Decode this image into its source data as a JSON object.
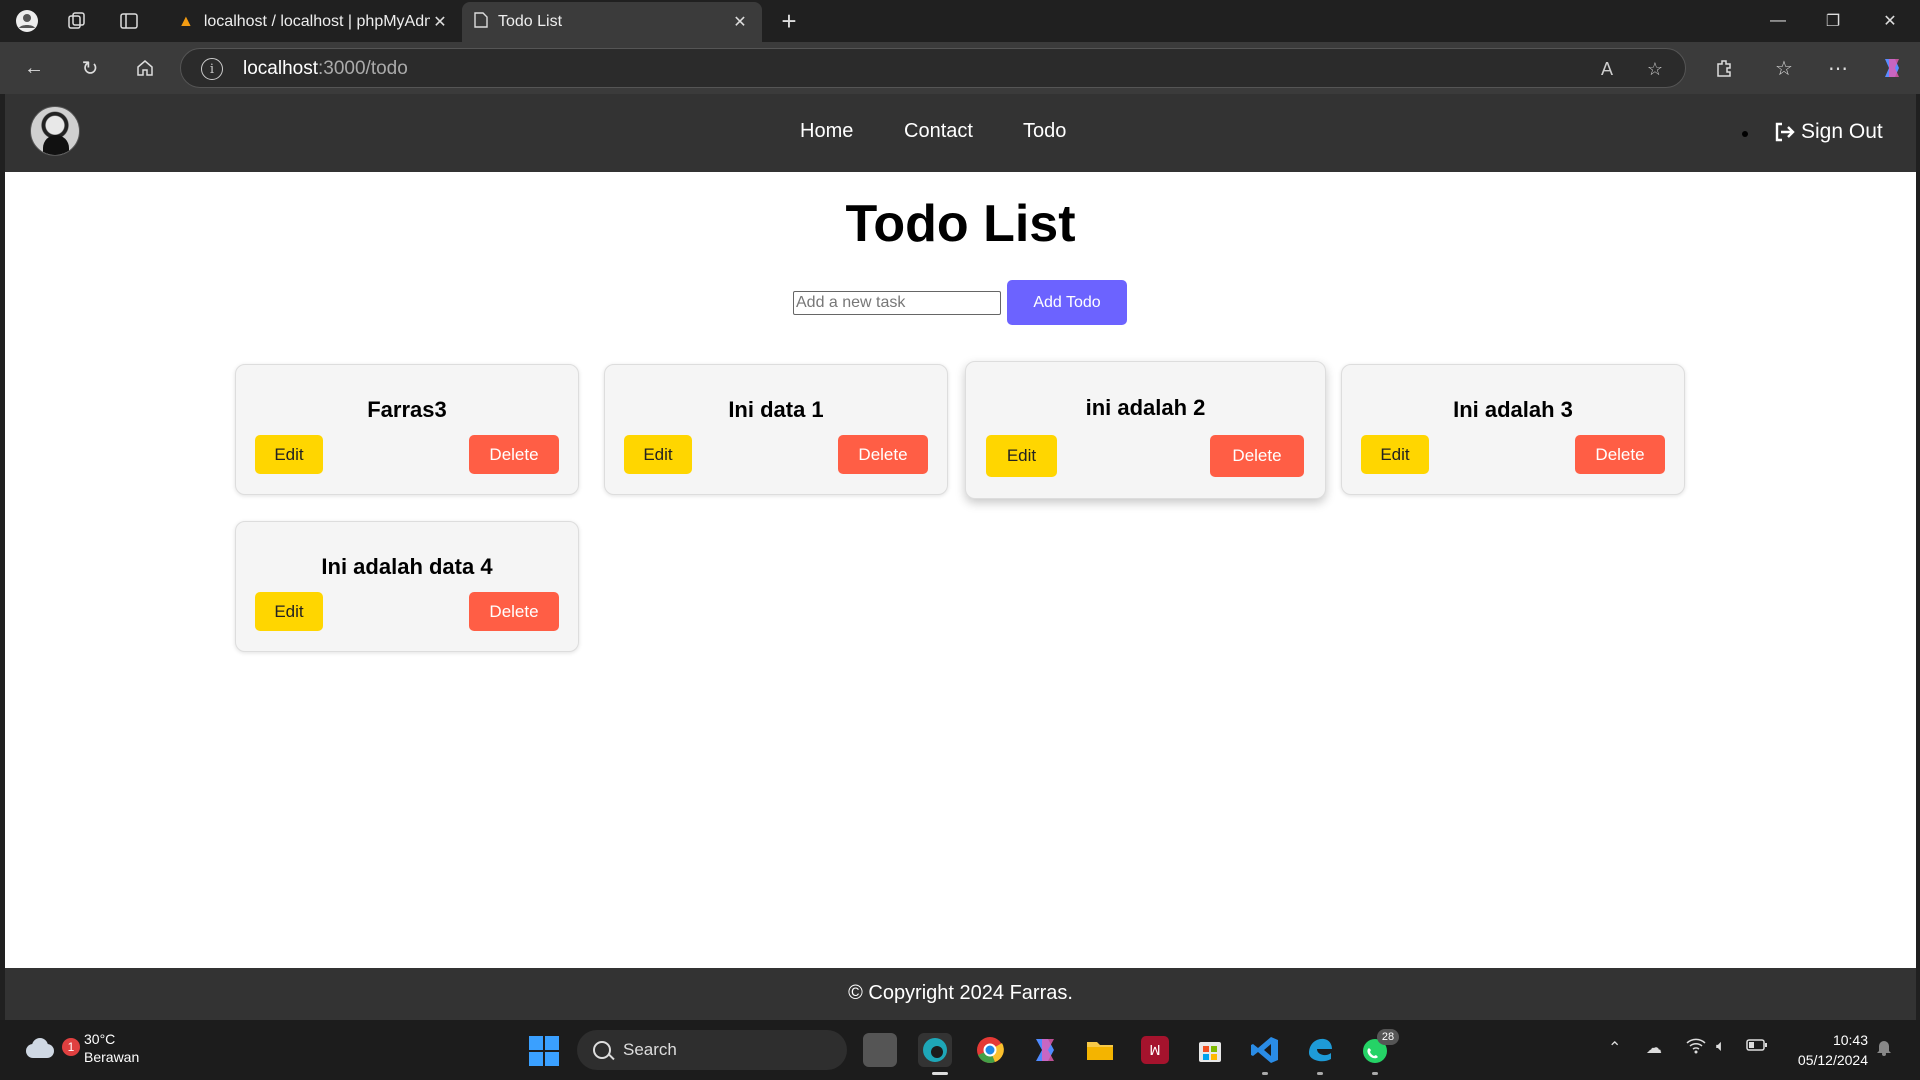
{
  "browser": {
    "tabs": [
      {
        "title": "localhost / localhost | phpMyAdm",
        "active": false
      },
      {
        "title": "Todo List",
        "active": true
      }
    ],
    "url_host": "localhost",
    "url_path": ":3000/todo"
  },
  "app": {
    "nav_links": [
      "Home",
      "Contact",
      "Todo"
    ],
    "sign_out": "Sign Out",
    "title": "Todo List",
    "input_placeholder": "Add a new task",
    "add_button": "Add Todo",
    "edit_label": "Edit",
    "delete_label": "Delete",
    "todos": [
      "Farras3",
      "Ini data 1",
      "ini adalah 2",
      "Ini adalah 3",
      "Ini adalah data 4"
    ],
    "footer": "© Copyright 2024 Farras."
  },
  "taskbar": {
    "weather_temp": "30°C",
    "weather_desc": "Berawan",
    "weather_badge": "1",
    "search": "Search",
    "whatsapp_badge": "28",
    "time": "10:43",
    "date": "05/12/2024"
  },
  "colors": {
    "accent": "#6c63ff",
    "edit": "#ffd600",
    "delete": "#ff5e45",
    "navbar": "#333333"
  }
}
